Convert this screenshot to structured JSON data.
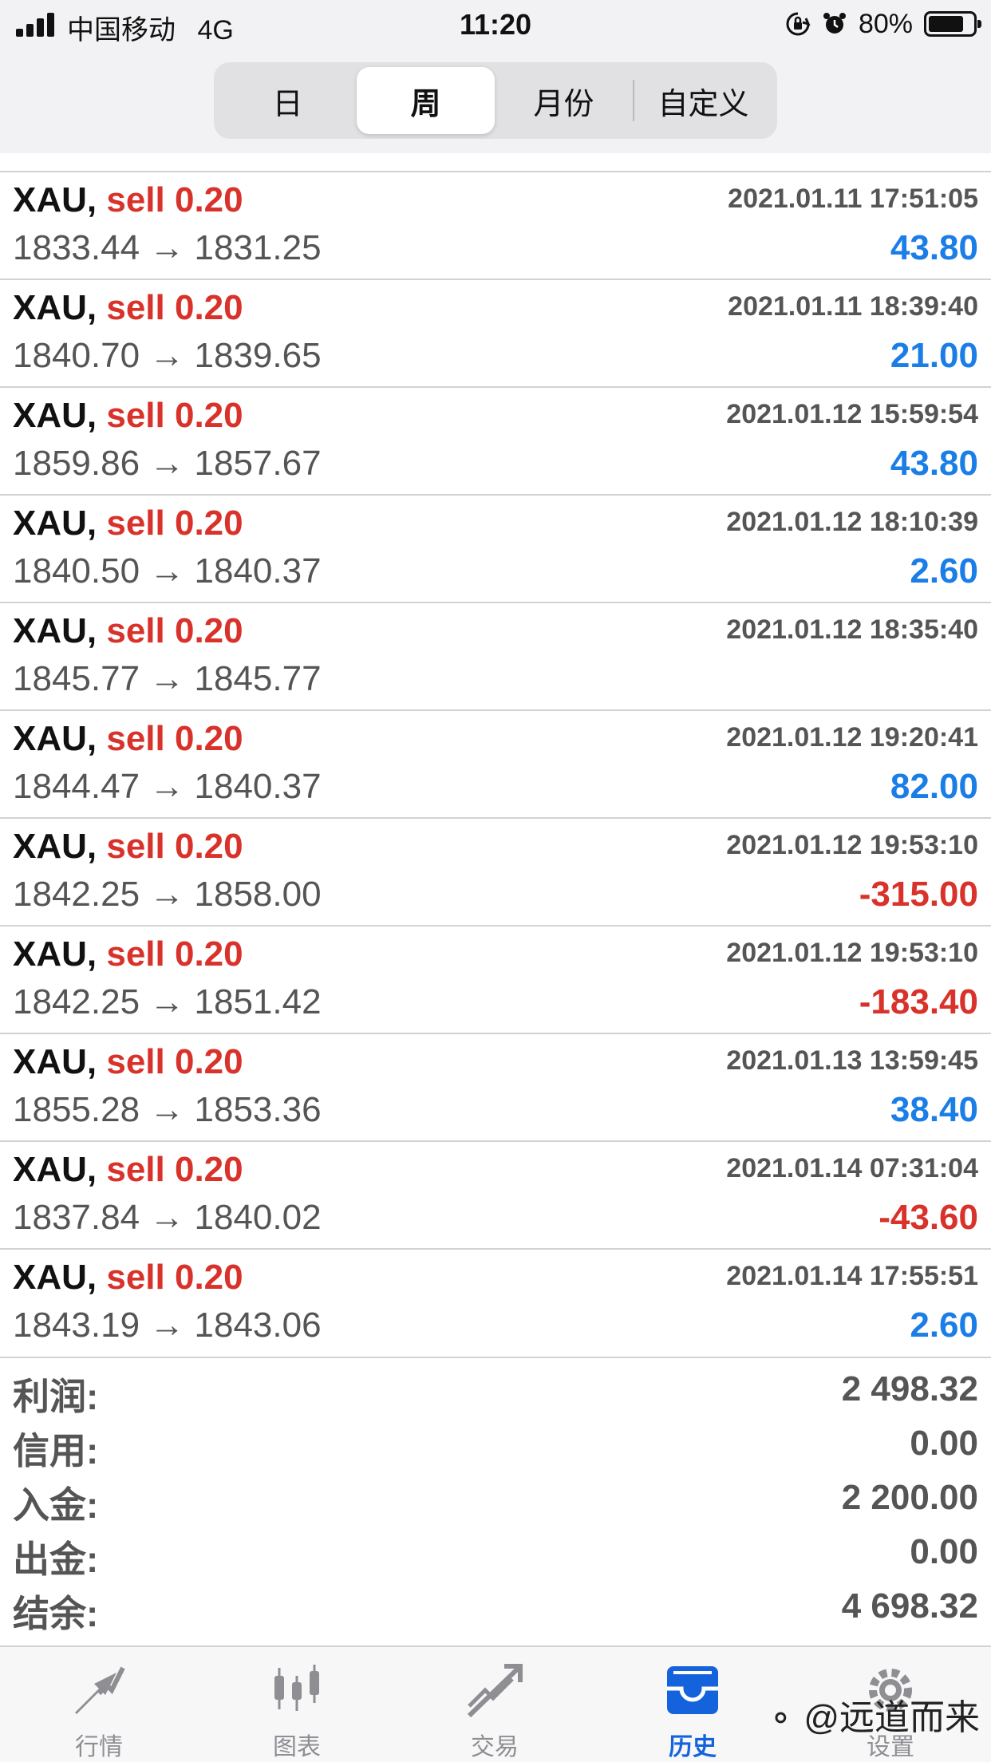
{
  "status_bar": {
    "carrier": "中国移动",
    "network": "4G",
    "time": "11:20",
    "battery": "80%",
    "battery_level": 0.8
  },
  "period_tabs": [
    {
      "label": "日",
      "active": false
    },
    {
      "label": "周",
      "active": true
    },
    {
      "label": "月份",
      "active": false
    },
    {
      "label": "自定义",
      "active": false
    }
  ],
  "deals": [
    {
      "symbol": "XAU,",
      "type": "sell 0.20",
      "time": "2021.01.11 17:51:05",
      "prices": "1833.44 → 1831.25",
      "profit": "43.80",
      "profit_sign": "pos"
    },
    {
      "symbol": "XAU,",
      "type": "sell 0.20",
      "time": "2021.01.11 18:39:40",
      "prices": "1840.70 → 1839.65",
      "profit": "21.00",
      "profit_sign": "pos"
    },
    {
      "symbol": "XAU,",
      "type": "sell 0.20",
      "time": "2021.01.12 15:59:54",
      "prices": "1859.86 → 1857.67",
      "profit": "43.80",
      "profit_sign": "pos"
    },
    {
      "symbol": "XAU,",
      "type": "sell 0.20",
      "time": "2021.01.12 18:10:39",
      "prices": "1840.50 → 1840.37",
      "profit": "2.60",
      "profit_sign": "pos"
    },
    {
      "symbol": "XAU,",
      "type": "sell 0.20",
      "time": "2021.01.12 18:35:40",
      "prices": "1845.77 → 1845.77",
      "profit": "",
      "profit_sign": "pos"
    },
    {
      "symbol": "XAU,",
      "type": "sell 0.20",
      "time": "2021.01.12 19:20:41",
      "prices": "1844.47 → 1840.37",
      "profit": "82.00",
      "profit_sign": "pos"
    },
    {
      "symbol": "XAU,",
      "type": "sell 0.20",
      "time": "2021.01.12 19:53:10",
      "prices": "1842.25 → 1858.00",
      "profit": "-315.00",
      "profit_sign": "neg"
    },
    {
      "symbol": "XAU,",
      "type": "sell 0.20",
      "time": "2021.01.12 19:53:10",
      "prices": "1842.25 → 1851.42",
      "profit": "-183.40",
      "profit_sign": "neg"
    },
    {
      "symbol": "XAU,",
      "type": "sell 0.20",
      "time": "2021.01.13 13:59:45",
      "prices": "1855.28 → 1853.36",
      "profit": "38.40",
      "profit_sign": "pos"
    },
    {
      "symbol": "XAU,",
      "type": "sell 0.20",
      "time": "2021.01.14 07:31:04",
      "prices": "1837.84 → 1840.02",
      "profit": "-43.60",
      "profit_sign": "neg"
    },
    {
      "symbol": "XAU,",
      "type": "sell 0.20",
      "time": "2021.01.14 17:55:51",
      "prices": "1843.19 → 1843.06",
      "profit": "2.60",
      "profit_sign": "pos"
    }
  ],
  "summary": [
    {
      "label": "利润:",
      "value": "2 498.32"
    },
    {
      "label": "信用:",
      "value": "0.00"
    },
    {
      "label": "入金:",
      "value": "2 200.00"
    },
    {
      "label": "出金:",
      "value": "0.00"
    },
    {
      "label": "结余:",
      "value": "4 698.32"
    }
  ],
  "tabbar": [
    {
      "label": "行情",
      "icon": "quotes-icon",
      "active": false
    },
    {
      "label": "图表",
      "icon": "chart-icon",
      "active": false
    },
    {
      "label": "交易",
      "icon": "trade-icon",
      "active": false
    },
    {
      "label": "历史",
      "icon": "history-icon",
      "active": true
    },
    {
      "label": "设置",
      "icon": "settings-icon",
      "active": false
    }
  ],
  "watermark": "@远道而来",
  "colors": {
    "sell": "#d8322b",
    "profit_positive": "#1b7ee6",
    "profit_negative": "#d8322b",
    "tab_active": "#1463dc"
  }
}
